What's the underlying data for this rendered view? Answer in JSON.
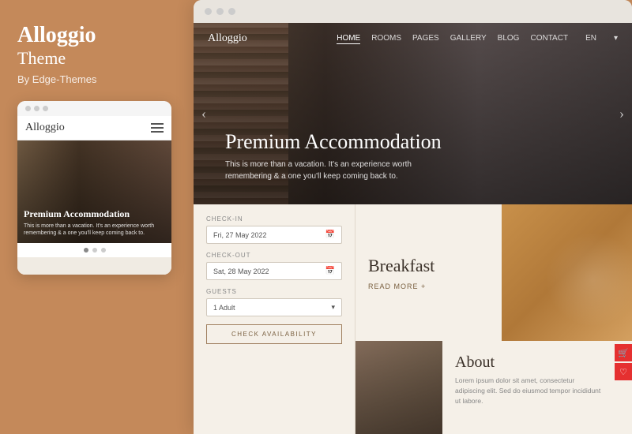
{
  "brand": {
    "title": "Alloggio",
    "subtitle": "Theme",
    "by": "By Edge-Themes"
  },
  "mobile": {
    "logo": "Alloggio",
    "hero_title": "Premium Accommodation",
    "hero_desc": "This is more than a vacation. It's an experience worth remembering & a one you'll keep coming back to."
  },
  "browser": {
    "nav": {
      "logo": "Alloggio",
      "links": [
        "HOME",
        "ROOMS",
        "PAGES",
        "GALLERY",
        "BLOG",
        "CONTACT"
      ],
      "lang": "EN"
    },
    "hero": {
      "title": "Premium Accommodation",
      "subtitle": "This is more than a vacation. It's an experience worth remembering & a one you'll keep coming back to."
    },
    "booking": {
      "checkin_label": "CHECK-IN",
      "checkin_value": "Fri, 27 May 2022",
      "checkout_label": "CHECK-OUT",
      "checkout_value": "Sat, 28 May 2022",
      "guests_label": "GUESTS",
      "guests_value": "1 Adult",
      "button_label": "CHECK AVAILABILITY"
    },
    "breakfast": {
      "title": "Breakfast",
      "read_more": "READ MORE +"
    },
    "about": {
      "title": "About",
      "text": "Lorem ipsum dolor sit amet, consectetur adipiscing elit. Sed do eiusmod tempor incididunt ut labore."
    }
  },
  "icons": {
    "calendar": "📅",
    "chevron_down": "▾",
    "left_arrow": "‹",
    "right_arrow": "›",
    "shopping": "🛒",
    "heart": "♡"
  }
}
